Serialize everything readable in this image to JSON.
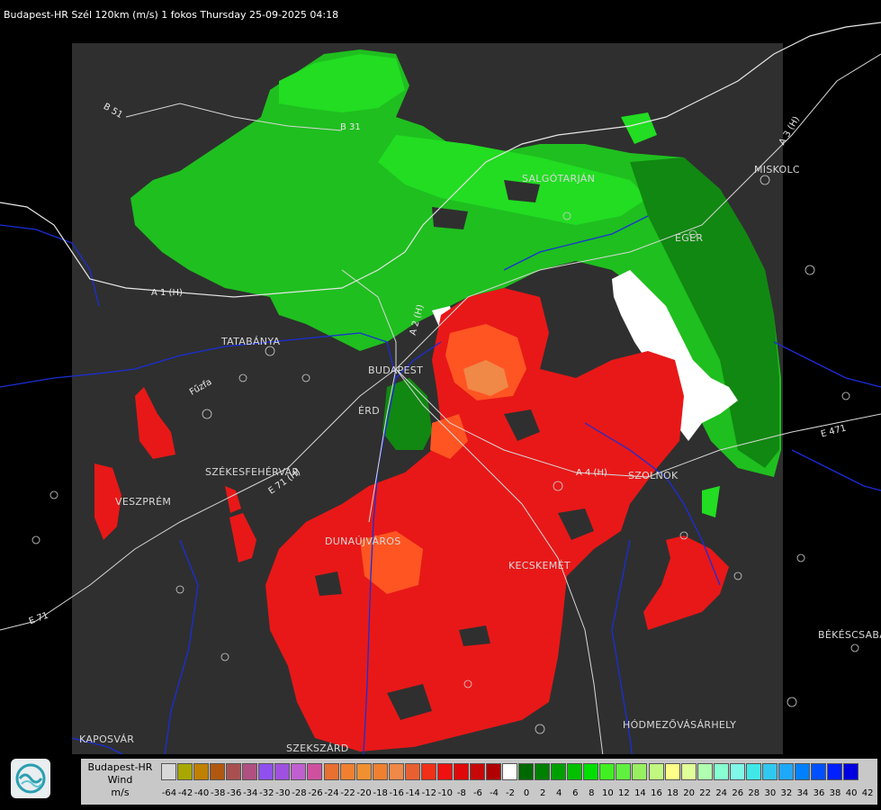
{
  "title": "Budapest-HR Szél 120km (m/s) 1 fokos Thursday 25-09-2025 04:18",
  "cities": [
    {
      "name": "SALGÓTARJÁN",
      "id": "salgotarjan"
    },
    {
      "name": "MISKOLC",
      "id": "miskolc"
    },
    {
      "name": "EGER",
      "id": "eger"
    },
    {
      "name": "TATABÁNYA",
      "id": "tatabanya"
    },
    {
      "name": "BUDAPEST",
      "id": "budapest"
    },
    {
      "name": "ÉRD",
      "id": "erd"
    },
    {
      "name": "SZÉKESFEHÉRVÁR",
      "id": "szekesfehervar"
    },
    {
      "name": "VESZPRÉM",
      "id": "veszprem"
    },
    {
      "name": "DUNAÚJVÁROS",
      "id": "dunaujvaros"
    },
    {
      "name": "KECSKEMÉT",
      "id": "kecskemet"
    },
    {
      "name": "SZOLNOK",
      "id": "szolnok"
    },
    {
      "name": "BÉKÉSCSABA",
      "id": "bekescsaba"
    },
    {
      "name": "HÓDMEZŐVÁSÁRHELY",
      "id": "hodmezovasarhely"
    },
    {
      "name": "KAPOSVÁR",
      "id": "kaposvar"
    },
    {
      "name": "SZEKSZÁRD",
      "id": "szekszard"
    }
  ],
  "roads": [
    "B 51",
    "B 31",
    "A 3 (H)",
    "A 1 (H)",
    "A 2 (H)",
    "A 4 (H)",
    "E 71 (H)",
    "E 471",
    "E 71",
    "Fűzfa"
  ],
  "legend": {
    "station": "Budapest-HR",
    "quantity": "Wind",
    "unit": "m/s",
    "ticks": [
      "-64",
      "-42",
      "-40",
      "-38",
      "-36",
      "-34",
      "-32",
      "-30",
      "-28",
      "-26",
      "-24",
      "-22",
      "-20",
      "-18",
      "-16",
      "-14",
      "-12",
      "-10",
      "-8",
      "-6",
      "-4",
      "-2",
      "0",
      "2",
      "4",
      "6",
      "8",
      "10",
      "12",
      "14",
      "16",
      "18",
      "20",
      "22",
      "24",
      "26",
      "28",
      "30",
      "32",
      "34",
      "36",
      "38",
      "40",
      "42"
    ],
    "colors": [
      "#d8d8d8",
      "#a8a800",
      "#c08000",
      "#b05810",
      "#a85050",
      "#b05080",
      "#9050f0",
      "#a050e0",
      "#c060d0",
      "#d050a0",
      "#e87030",
      "#f08030",
      "#f09030",
      "#f08030",
      "#f08848",
      "#e86030",
      "#f03018",
      "#f01010",
      "#e00808",
      "#c80808",
      "#b00000",
      "#ffffff",
      "#006800",
      "#008000",
      "#00a000",
      "#00c000",
      "#00e000",
      "#40f020",
      "#60f040",
      "#98f060",
      "#c0f880",
      "#ffff88",
      "#e0ff98",
      "#b0ffb0",
      "#88ffd0",
      "#80f8e8",
      "#40e8e8",
      "#30c8f0",
      "#20a8f8",
      "#0080ff",
      "#0050ff",
      "#0020ff",
      "#0000e0"
    ]
  }
}
